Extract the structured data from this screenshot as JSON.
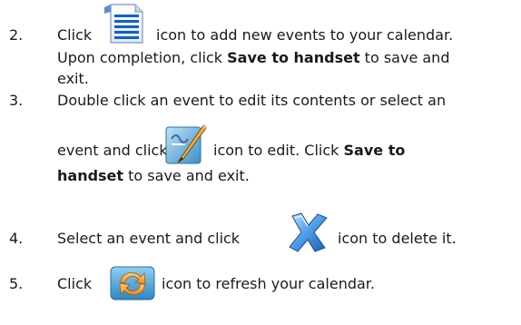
{
  "steps": [
    {
      "number": "2.",
      "l1_a": "Click",
      "l1_b": "icon to add new events to your calendar.",
      "l2_a": "Upon completion, click ",
      "l2_bold": "Save to handset",
      "l2_b": " to save and",
      "l3": "exit.",
      "icon": "new-event-document-icon"
    },
    {
      "number": "3.",
      "l1": "Double click an event to edit its contents or select an",
      "l2_a": "event and click",
      "l2_b": "icon to edit. Click ",
      "l2_bold": "Save to",
      "l3_bold": "handset",
      "l3_b": " to save and exit.",
      "icon": "edit-pen-icon"
    },
    {
      "number": "4.",
      "l1_a": "Select an event and click",
      "l1_b": "icon to delete it.",
      "icon": "delete-x-icon"
    },
    {
      "number": "5.",
      "l1_a": "Click",
      "l1_b": "icon to refresh your calendar.",
      "icon": "refresh-icon"
    }
  ]
}
